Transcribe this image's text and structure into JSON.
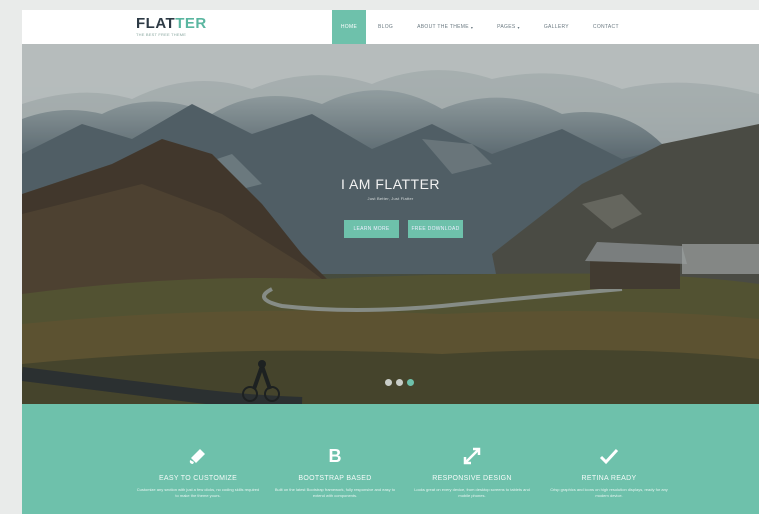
{
  "header": {
    "logo": "FLAT",
    "logo_accent": "TER",
    "tagline": "THE BEST FREE THEME",
    "nav": [
      {
        "label": "Home",
        "active": true
      },
      {
        "label": "Blog",
        "active": false
      },
      {
        "label": "About The Theme",
        "active": false,
        "caret": "▾"
      },
      {
        "label": "Pages",
        "active": false,
        "caret": "▾"
      },
      {
        "label": "Gallery",
        "active": false
      },
      {
        "label": "Contact",
        "active": false
      }
    ]
  },
  "hero": {
    "title": "I AM FLATTER",
    "subtitle": "Just Better, Just Flatter",
    "buttons": [
      "Learn More",
      "Free Download"
    ],
    "slides_total": 3,
    "slide_active": 3
  },
  "features": [
    {
      "icon": "brush-icon",
      "title": "Easy to Customize",
      "text": "Customize any section with just a few clicks, no coding skills required to make the theme yours."
    },
    {
      "icon": "bootstrap-icon",
      "glyph": "B",
      "title": "Bootstrap Based",
      "text": "Built on the latest Bootstrap framework, fully responsive and easy to extend with components."
    },
    {
      "icon": "expand-icon",
      "title": "Responsive Design",
      "text": "Looks great on every device, from desktop screens to tablets and mobile phones."
    },
    {
      "icon": "check-icon",
      "title": "Retina Ready",
      "text": "Crisp graphics and icons on high resolution displays, ready for any modern device."
    }
  ],
  "colors": {
    "accent": "#6ec1ab",
    "text_dark": "#2d3a45"
  }
}
